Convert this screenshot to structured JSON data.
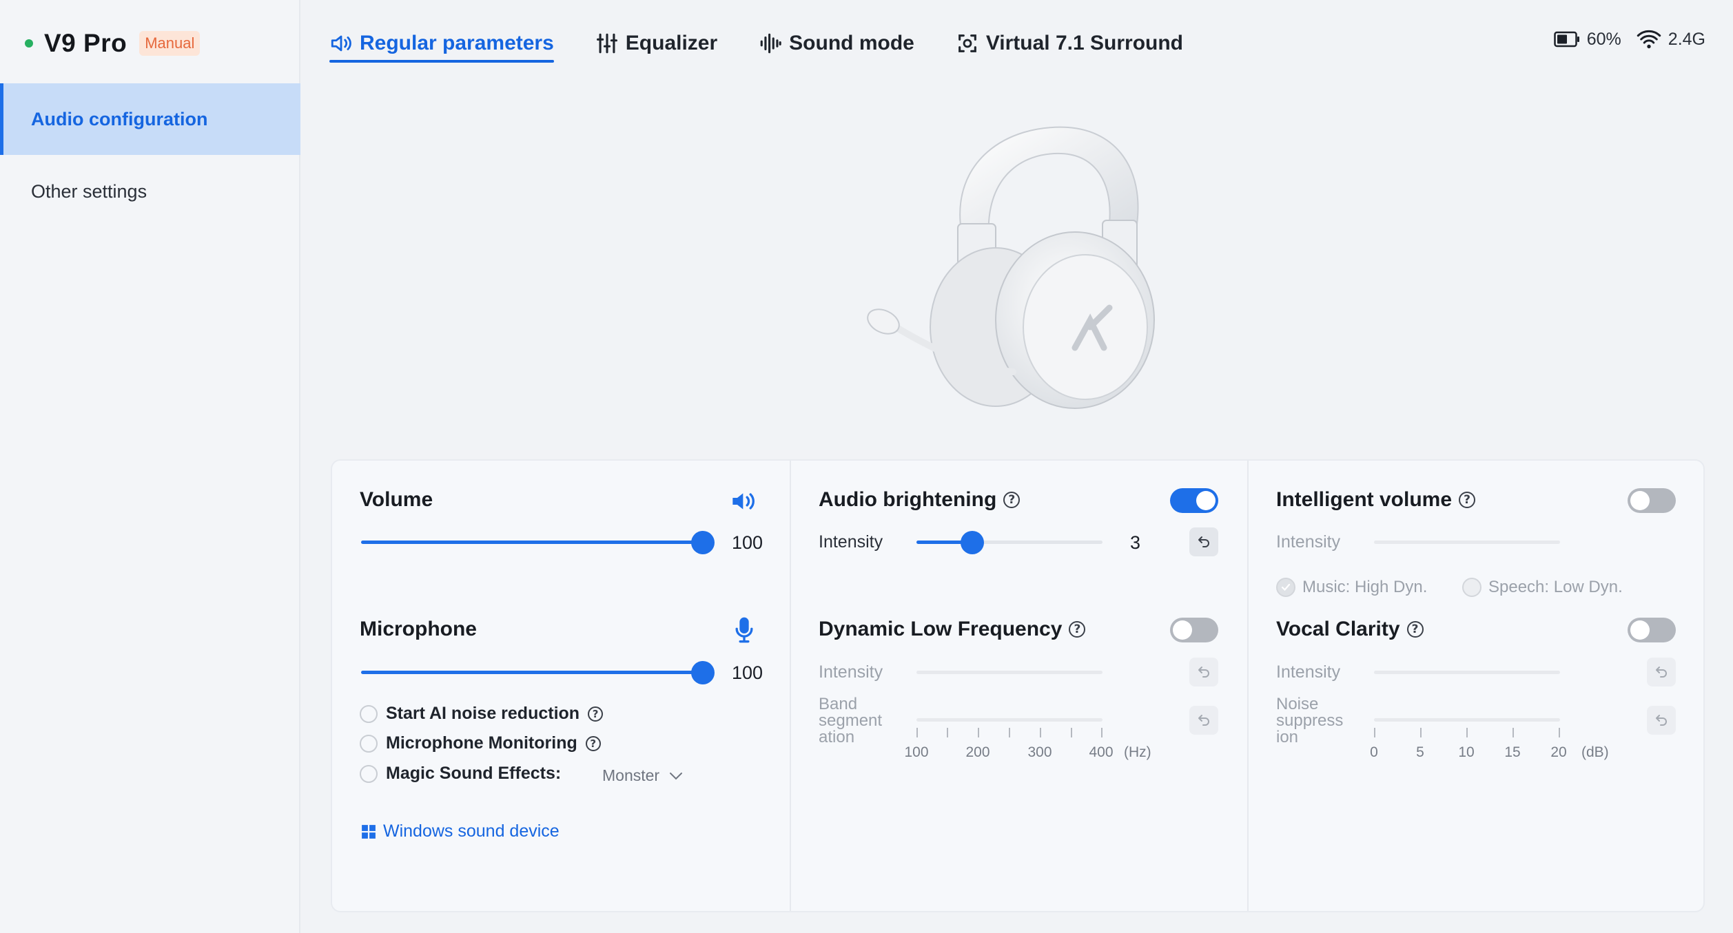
{
  "app": {
    "device_name": "V9 Pro",
    "mode_badge": "Manual"
  },
  "sidebar": {
    "items": [
      {
        "label": "Audio configuration",
        "active": true
      },
      {
        "label": "Other settings",
        "active": false
      }
    ]
  },
  "tabs": [
    {
      "label": "Regular parameters",
      "icon": "speaker-icon",
      "active": true
    },
    {
      "label": "Equalizer",
      "icon": "equalizer-icon",
      "active": false
    },
    {
      "label": "Sound mode",
      "icon": "waveform-icon",
      "active": false
    },
    {
      "label": "Virtual 7.1 Surround",
      "icon": "surround-icon",
      "active": false
    }
  ],
  "status": {
    "battery": "60%",
    "wireless": "2.4G"
  },
  "volume": {
    "title": "Volume",
    "value": "100",
    "level": 1.0
  },
  "microphone": {
    "title": "Microphone",
    "value": "100",
    "level": 1.0,
    "options": [
      {
        "label": "Start AI noise reduction",
        "help": true
      },
      {
        "label": "Microphone Monitoring",
        "help": true
      },
      {
        "label": "Magic Sound Effects:",
        "help": false
      }
    ],
    "effect_value": "Monster",
    "windows_link": "Windows sound device"
  },
  "audio_brightening": {
    "title": "Audio brightening",
    "enabled": true,
    "intensity_label": "Intensity",
    "intensity_value": "3",
    "level": 0.3
  },
  "dynamic_low_frequency": {
    "title": "Dynamic Low Frequency",
    "enabled": false,
    "intensity_label": "Intensity",
    "band_label_1": "Band",
    "band_label_2": "segment",
    "band_label_3": "ation",
    "ticks": [
      "100",
      "200",
      "300",
      "400"
    ],
    "unit": "(Hz)"
  },
  "intelligent_volume": {
    "title": "Intelligent volume",
    "enabled": false,
    "intensity_label": "Intensity",
    "option_music": "Music: High Dyn.",
    "option_speech": "Speech: Low Dyn."
  },
  "vocal_clarity": {
    "title": "Vocal Clarity",
    "enabled": false,
    "intensity_label": "Intensity",
    "noise_label_1": "Noise",
    "noise_label_2": "suppress",
    "noise_label_3": "ion",
    "ticks": [
      "0",
      "5",
      "10",
      "15",
      "20"
    ],
    "unit": "(dB)"
  },
  "colors": {
    "accent": "#1e6fe8",
    "active_nav_bg": "#c7dcf8",
    "badge_text": "#e6683c",
    "status_dot": "#27b061"
  }
}
